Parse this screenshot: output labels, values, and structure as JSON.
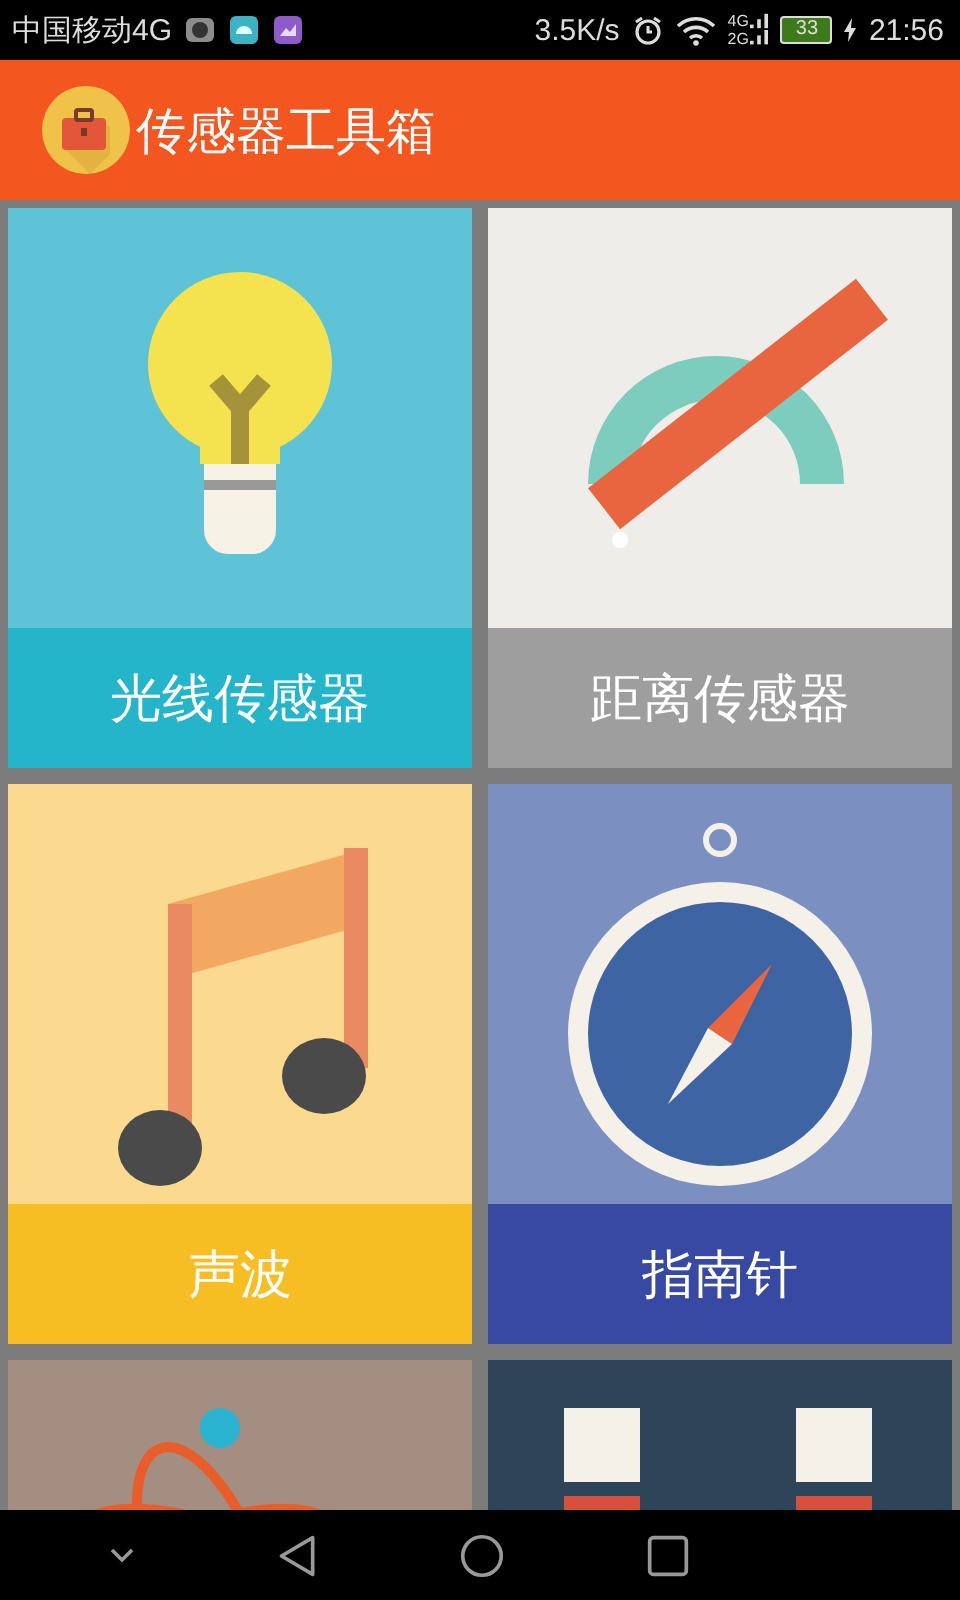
{
  "status_bar": {
    "carrier": "中国移动4G",
    "speed": "3.5K/s",
    "network_top": "4G",
    "network_bottom": "2G",
    "battery": "33",
    "time": "21:56"
  },
  "app_bar": {
    "title": "传感器工具箱"
  },
  "tiles": [
    {
      "kind": "bulb",
      "color": "#5fc3d7",
      "label": {
        "text": "光线传感器",
        "color": "#25b5cb"
      }
    },
    {
      "kind": "ruler",
      "color": "#efedea",
      "label": {
        "text": "距离传感器",
        "color": "#9e9e9e"
      }
    },
    {
      "kind": "music",
      "color": "#fbd98e",
      "label": {
        "text": "声波",
        "color": "#f6be23"
      }
    },
    {
      "kind": "compass",
      "color": "#7b8fc0",
      "label": {
        "text": "指南针",
        "color": "#3749a3"
      }
    },
    {
      "kind": "atom",
      "color": "#a48e82"
    },
    {
      "kind": "robot",
      "color": "#2e4459"
    }
  ]
}
